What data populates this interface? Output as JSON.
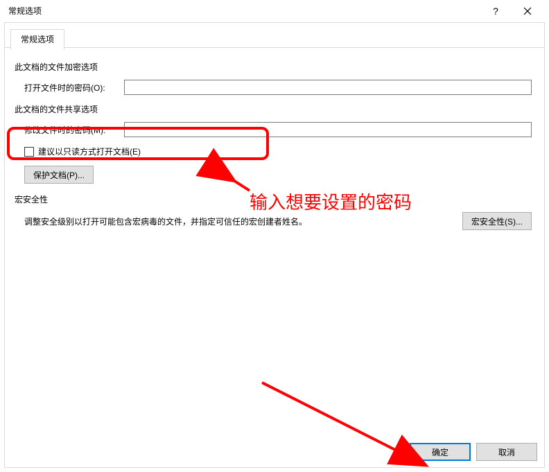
{
  "window": {
    "title": "常规选项"
  },
  "tab": {
    "label": "常规选项"
  },
  "encrypt_section": {
    "title": "此文档的文件加密选项",
    "open_pw_label": "打开文件时的密码(O):",
    "open_pw_value": ""
  },
  "share_section": {
    "title": "此文档的文件共享选项",
    "modify_pw_label": "修改文件时的密码(M):",
    "modify_pw_value": "",
    "readonly_label": "建议以只读方式打开文档(E)",
    "protect_btn": "保护文档(P)..."
  },
  "macro_section": {
    "title": "宏安全性",
    "desc": "调整安全级别以打开可能包含宏病毒的文件，并指定可信任的宏创建者姓名。",
    "btn": "宏安全性(S)..."
  },
  "footer": {
    "ok": "确定",
    "cancel": "取消"
  },
  "annotation": {
    "text": "输入想要设置的密码"
  }
}
